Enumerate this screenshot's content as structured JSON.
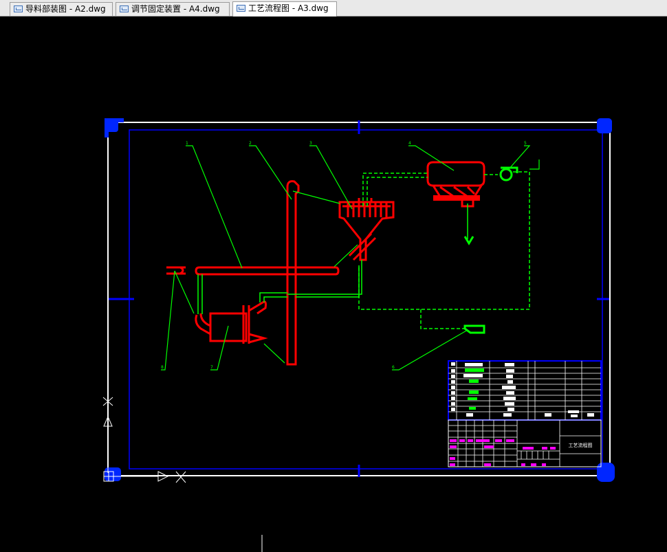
{
  "tabs": [
    {
      "label": "导料部装图 - A2.dwg",
      "active": false
    },
    {
      "label": "调节固定装置 - A4.dwg",
      "active": false
    },
    {
      "label": "工艺流程图 - A3.dwg",
      "active": true
    }
  ],
  "drawing": {
    "title_block_name": "工艺流程图"
  },
  "colors": {
    "background": "#000000",
    "frame": "#ffffff",
    "inner_frame": "#0000ff",
    "equipment": "#ff0000",
    "leader": "#00ff00",
    "grip": "#0026ff",
    "table_text": "#ff00ff"
  },
  "icons": [
    "dwg-file-icon",
    "ucs-icon",
    "cursor-crosshair-icon"
  ]
}
